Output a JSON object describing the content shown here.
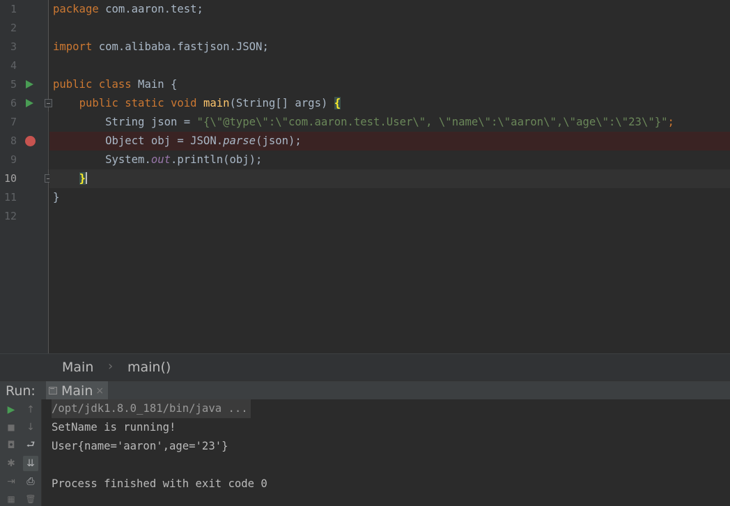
{
  "editor": {
    "line_numbers": [
      "1",
      "2",
      "3",
      "4",
      "5",
      "6",
      "7",
      "8",
      "9",
      "10",
      "11",
      "12"
    ],
    "tokens": {
      "l1_kw": "package",
      "l1_rest": " com.aaron.test;",
      "l3_kw": "import",
      "l3_rest": " com.alibaba.fastjson.JSON;",
      "l5_kw": "public class",
      "l5_rest": " Main {",
      "l6_indent": "    ",
      "l6_kw": "public static void",
      "l6_sp": " ",
      "l6_fn": "main",
      "l6_params": "(String[] args) ",
      "l6_brace": "{",
      "l7_indent": "        ",
      "l7_pre": "String json = ",
      "l7_str": "\"{\\\"@type\\\":\\\"com.aaron.test.User\\\", \\\"name\\\":\\\"aaron\\\",\\\"age\\\":\\\"23\\\"}\"",
      "l7_end": ";",
      "l8_indent": "        ",
      "l8_pre": "Object obj = JSON.",
      "l8_method": "parse",
      "l8_post": "(json);",
      "l9_indent": "        ",
      "l9_pre": "System.",
      "l9_field": "out",
      "l9_post": ".println(obj);",
      "l10_indent": "    ",
      "l10_brace": "}",
      "l11_brace": "}"
    }
  },
  "breadcrumb": {
    "items": [
      "Main",
      "main()"
    ],
    "separator": "›"
  },
  "run_panel": {
    "title": "Run:",
    "tab_label": "Main",
    "tab_close": "×",
    "output": [
      "/opt/jdk1.8.0_181/bin/java ...",
      "SetName is running!",
      "User{name='aaron',age='23'}",
      "",
      "Process finished with exit code 0"
    ]
  },
  "toolbar": {
    "rerun": "▶",
    "up": "↑",
    "stop": "■",
    "down": "↓",
    "camera": "◘",
    "soft_wrap": "⮐",
    "settings": "✱",
    "scroll_to_end": "⇊",
    "login": "⇥",
    "print": "⎙",
    "layout": "▦",
    "trash": "🗑"
  },
  "colors": {
    "keyword": "#cc7832",
    "function": "#ffc66d",
    "string": "#6a8759",
    "static_field": "#9876aa",
    "run_icon": "#499c54",
    "breakpoint": "#c75450",
    "background": "#2b2b2b"
  }
}
